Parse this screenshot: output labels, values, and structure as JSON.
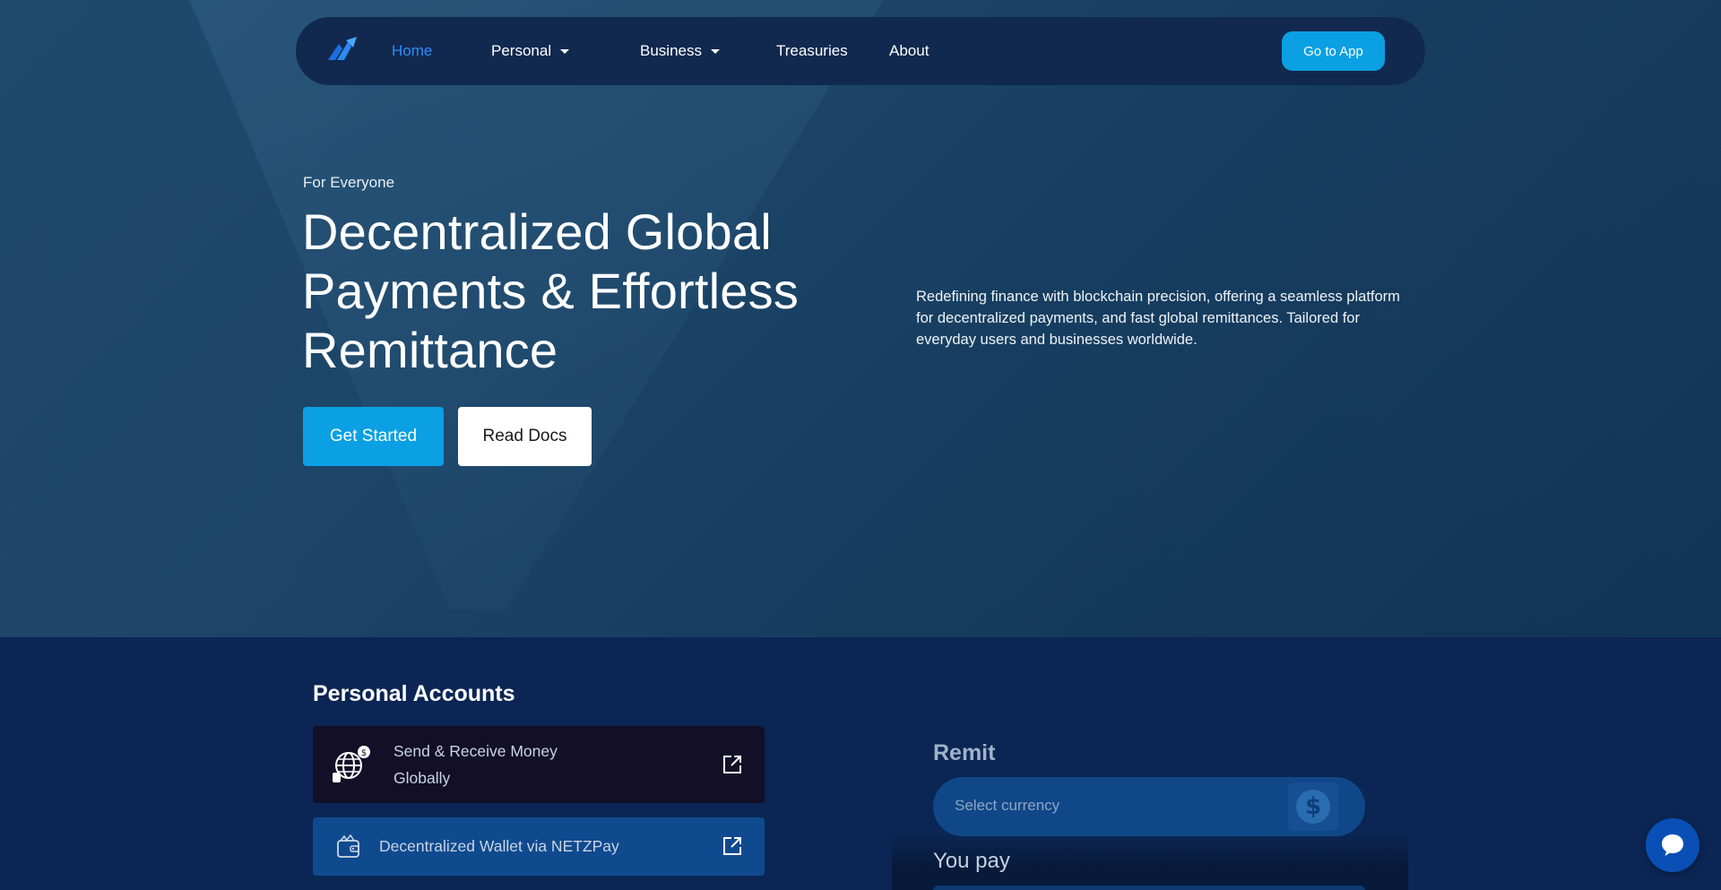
{
  "nav": {
    "items": [
      {
        "label": "Home",
        "active": true,
        "dropdown": false
      },
      {
        "label": "Personal",
        "active": false,
        "dropdown": true
      },
      {
        "label": "Business",
        "active": false,
        "dropdown": true
      },
      {
        "label": "Treasuries",
        "active": false,
        "dropdown": false
      },
      {
        "label": "About",
        "active": false,
        "dropdown": false
      }
    ],
    "cta_label": "Go to App",
    "logo_icon": "netz-logo-icon"
  },
  "hero": {
    "eyebrow": "For Everyone",
    "headline": "Decentralized Global Payments & Effortless Remittance",
    "description": "Redefining finance with blockchain precision, offering a seamless platform for decentralized payments, and fast global remittances. Tailored for everyday users and businesses worldwide.",
    "primary_button": "Get Started",
    "secondary_button": "Read Docs"
  },
  "personal": {
    "title": "Personal Accounts",
    "cards": [
      {
        "label": "Send & Receive Money Globally",
        "icon": "globe-money-icon"
      },
      {
        "label": "Decentralized Wallet via NETZPay",
        "icon": "wallet-icon"
      }
    ]
  },
  "remit": {
    "title": "Remit",
    "currency_placeholder": "Select currency",
    "currency_icon": "dollar-icon",
    "you_pay_label": "You pay"
  },
  "colors": {
    "accent": "#0aa0e3",
    "active_nav": "#2d8cff",
    "nav_bg": "#11294f",
    "section_bg": "#0b2654"
  }
}
